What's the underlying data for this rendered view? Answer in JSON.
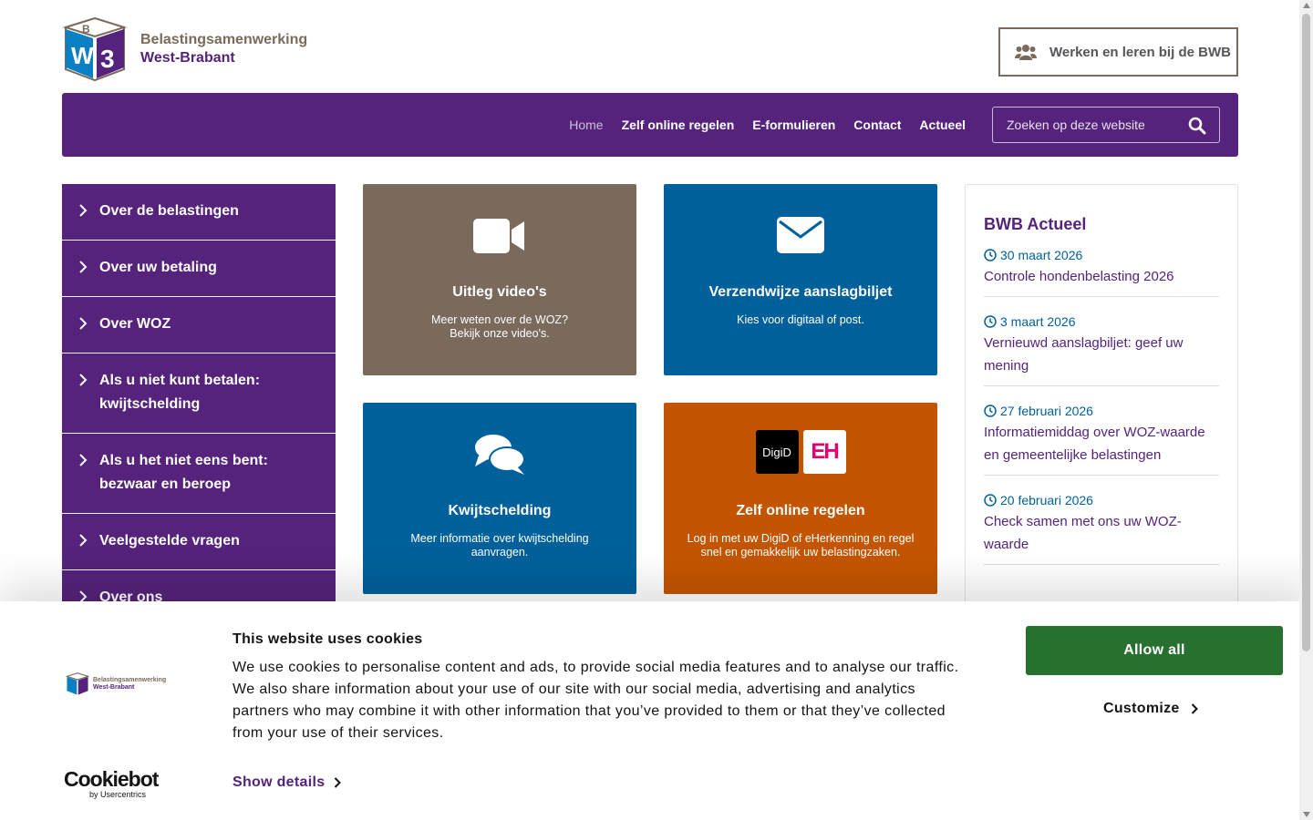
{
  "header": {
    "logo_line1": "Belastingsamenwerking",
    "logo_line2": "West-Brabant",
    "work_button": "Werken en leren bij de BWB"
  },
  "nav": {
    "items": [
      {
        "label": "Home",
        "active": true
      },
      {
        "label": "Zelf online regelen"
      },
      {
        "label": "E-formulieren"
      },
      {
        "label": "Contact"
      },
      {
        "label": "Actueel"
      }
    ],
    "search_placeholder": "Zoeken op deze website"
  },
  "sidebar": {
    "items": [
      {
        "label": "Over de belastingen"
      },
      {
        "label": "Over uw betaling"
      },
      {
        "label": "Over WOZ"
      },
      {
        "label": "Als u niet kunt betalen: kwijtschelding"
      },
      {
        "label": "Als u het niet eens bent: bezwaar en beroep"
      },
      {
        "label": "Veelgestelde vragen"
      },
      {
        "label": "Over ons"
      }
    ]
  },
  "tiles": [
    {
      "title": "Uitleg video's",
      "desc_line1": "Meer weten over de WOZ?",
      "desc_line2": "Bekijk onze video's.",
      "icon": "video-camera-icon"
    },
    {
      "title": "Verzendwijze aanslagbiljet",
      "desc_line1": "Kies voor digitaal of post.",
      "icon": "envelope-icon"
    },
    {
      "title": "Kwijtschelding",
      "desc_line1": "Meer informatie over kwijtschelding aanvragen.",
      "icon": "chat-bubbles-icon"
    },
    {
      "title": "Zelf online regelen",
      "desc_line1": "Log in met uw DigiD of eHerkenning en regel snel en gemakkelijk uw belastingzaken.",
      "icon": "digid-eherkenning-logos",
      "digid_label": "DigiD",
      "eh_label": "EH"
    }
  ],
  "news": {
    "title": "BWB Actueel",
    "items": [
      {
        "date": "30 maart 2026",
        "title": "Controle hondenbelasting 2026"
      },
      {
        "date": "3 maart 2026",
        "title": "Vernieuwd aanslagbiljet: geef uw mening"
      },
      {
        "date": "27 februari 2026",
        "title": "Informatiemiddag over WOZ-waarde en gemeentelijke belastingen"
      },
      {
        "date": "20 februari 2026",
        "title": "Check samen met ons uw WOZ-waarde"
      }
    ]
  },
  "cookie": {
    "title": "This website uses cookies",
    "text": "We use cookies to personalise content and ads, to provide social media features and to analyse our traffic. We also share information about your use of our site with our social media, advertising and analytics partners who may combine it with other information that you’ve provided to them or that they’ve collected from your use of their services.",
    "show_details": "Show details",
    "allow_all": "Allow all",
    "customize": "Customize",
    "cookiebot_brand": "Cookiebot",
    "cookiebot_by": "by Usercentrics",
    "mini_logo_line1": "Belastingsamenwerking",
    "mini_logo_line2": "West-Brabant"
  },
  "colors": {
    "purple": "#55237b",
    "brown": "#7a6a5c",
    "blue": "#00609b",
    "orange": "#c35500",
    "green": "#28702f"
  }
}
